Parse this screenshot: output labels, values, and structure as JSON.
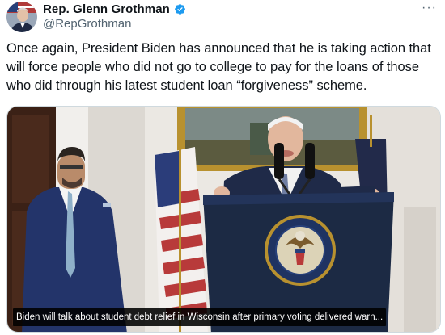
{
  "author": {
    "display_name": "Rep. Glenn Grothman",
    "handle": "@RepGrothman",
    "verified_icon": "verified-badge-icon",
    "avatar_icon": "profile-avatar"
  },
  "actions": {
    "more_label": "···"
  },
  "tweet": {
    "text": "Once again, President Biden has announced that he is taking action that will force people who did not go to college to pay for the loans of those who did through his latest student loan “forgiveness” scheme."
  },
  "media": {
    "caption": "Biden will talk about student debt relief in Wisconsin after primary voting delivered warn...",
    "seal_text": "SEAL OF THE PRESIDENT OF THE UNITED STATES"
  },
  "colors": {
    "verified_blue": "#1d9bf0",
    "text_primary": "#0f1419",
    "text_secondary": "#536471",
    "podium_navy": "#1c2a44"
  }
}
